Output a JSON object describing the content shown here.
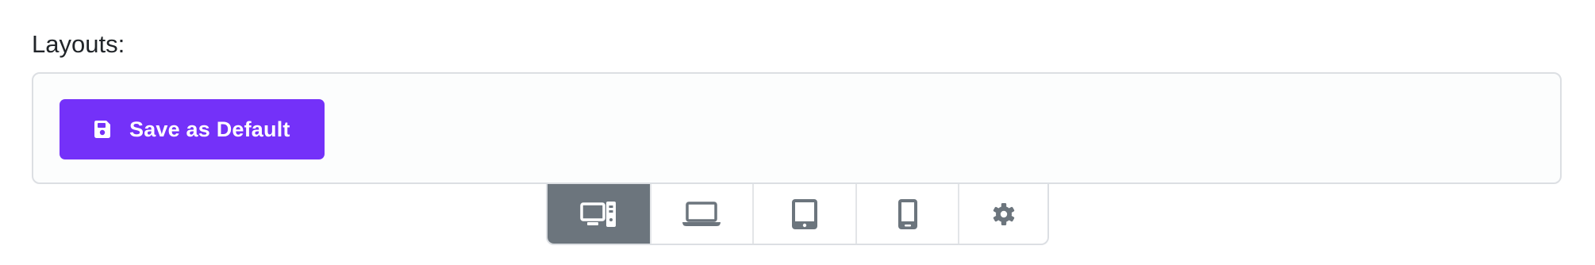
{
  "layouts": {
    "label": "Layouts:",
    "save_button": {
      "label": "Save as Default",
      "icon": "floppy-disk-icon"
    }
  },
  "device_tabs": [
    {
      "icon": "desktop-icon",
      "active": true
    },
    {
      "icon": "laptop-icon",
      "active": false
    },
    {
      "icon": "tablet-icon",
      "active": false
    },
    {
      "icon": "mobile-icon",
      "active": false
    },
    {
      "icon": "gear-icon",
      "active": false
    }
  ],
  "colors": {
    "accent": "#7431f9",
    "active_tab": "#6c757d",
    "icon_gray": "#6c757d",
    "border": "#dcdfe3"
  }
}
